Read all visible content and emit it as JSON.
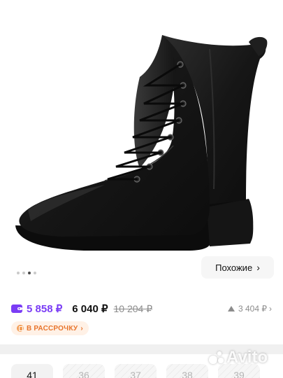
{
  "gallery": {
    "image_alt": "black leather lace-up boot",
    "dots_count": 4,
    "active_dot": 2,
    "similar_label": "Похожие"
  },
  "price": {
    "wallet_price": "5 858 ₽",
    "current_price": "6 040 ₽",
    "old_price": "10 204 ₽",
    "price_drop": "3 404 ₽",
    "wallet_color": "#7a3cf5"
  },
  "installment": {
    "label": "В РАССРОЧКУ"
  },
  "sizes": [
    {
      "label": "41",
      "available": true,
      "selected": true
    },
    {
      "label": "36",
      "available": false
    },
    {
      "label": "37",
      "available": false
    },
    {
      "label": "38",
      "available": false
    },
    {
      "label": "39",
      "available": false
    }
  ],
  "watermark": {
    "brand": "Avito"
  }
}
